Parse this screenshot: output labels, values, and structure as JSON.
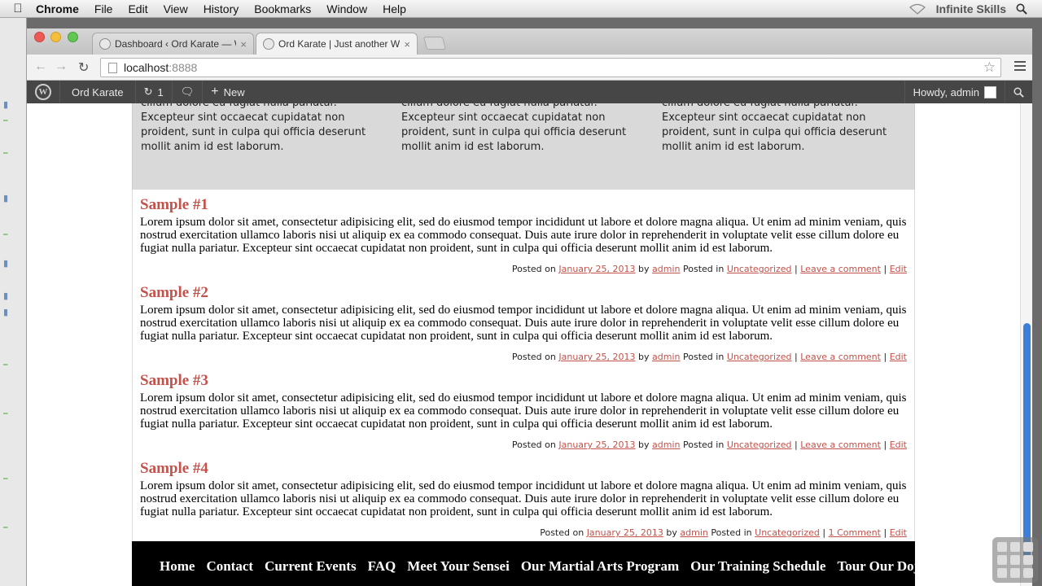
{
  "mac_menu": {
    "app": "Chrome",
    "items": [
      "File",
      "Edit",
      "View",
      "History",
      "Bookmarks",
      "Window",
      "Help"
    ],
    "brand": "Infinite Skills"
  },
  "browser": {
    "tabs": [
      {
        "title": "Dashboard ‹ Ord Karate — W",
        "close": "×"
      },
      {
        "title": "Ord Karate | Just another W",
        "close": "×"
      }
    ],
    "url_host": "localhost",
    "url_port": ":8888"
  },
  "wp_admin_bar": {
    "site_name": "Ord Karate",
    "updates_count": "1",
    "new_label": "New",
    "greeting": "Howdy, admin"
  },
  "footer_widgets": [
    {
      "text": "cillum dolore eu fugiat nulla pariatur. Excepteur sint occaecat cupidatat non proident, sunt in culpa qui officia deserunt mollit anim id est laborum."
    },
    {
      "text": "cillum dolore eu fugiat nulla pariatur. Excepteur sint occaecat cupidatat non proident, sunt in culpa qui officia deserunt mollit anim id est laborum."
    },
    {
      "text": "cillum dolore eu fugiat nulla pariatur. Excepteur sint occaecat cupidatat non proident, sunt in culpa qui officia deserunt mollit anim id est laborum."
    }
  ],
  "posts": [
    {
      "title": "Sample #1",
      "body": "Lorem ipsum dolor sit amet, consectetur adipisicing elit, sed do eiusmod tempor incididunt ut labore et dolore magna aliqua. Ut enim ad minim veniam, quis nostrud exercitation ullamco laboris nisi ut aliquip ex ea commodo consequat. Duis aute irure dolor in reprehenderit in voluptate velit esse cillum dolore eu fugiat nulla pariatur. Excepteur sint occaecat cupidatat non proident, sunt in culpa qui officia deserunt mollit anim id est laborum.",
      "posted_on": "Posted on",
      "date": "January 25, 2013",
      "by": "by",
      "author": "admin",
      "posted_in": "Posted in",
      "category": "Uncategorized",
      "sep": "|",
      "comment": "Leave a comment",
      "edit": "Edit"
    },
    {
      "title": "Sample #2",
      "body": "Lorem ipsum dolor sit amet, consectetur adipisicing elit, sed do eiusmod tempor incididunt ut labore et dolore magna aliqua. Ut enim ad minim veniam, quis nostrud exercitation ullamco laboris nisi ut aliquip ex ea commodo consequat. Duis aute irure dolor in reprehenderit in voluptate velit esse cillum dolore eu fugiat nulla pariatur. Excepteur sint occaecat cupidatat non proident, sunt in culpa qui officia deserunt mollit anim id est laborum.",
      "posted_on": "Posted on",
      "date": "January 25, 2013",
      "by": "by",
      "author": "admin",
      "posted_in": "Posted in",
      "category": "Uncategorized",
      "sep": "|",
      "comment": "Leave a comment",
      "edit": "Edit"
    },
    {
      "title": "Sample #3",
      "body": "Lorem ipsum dolor sit amet, consectetur adipisicing elit, sed do eiusmod tempor incididunt ut labore et dolore magna aliqua. Ut enim ad minim veniam, quis nostrud exercitation ullamco laboris nisi ut aliquip ex ea commodo consequat. Duis aute irure dolor in reprehenderit in voluptate velit esse cillum dolore eu fugiat nulla pariatur. Excepteur sint occaecat cupidatat non proident, sunt in culpa qui officia deserunt mollit anim id est laborum.",
      "posted_on": "Posted on",
      "date": "January 25, 2013",
      "by": "by",
      "author": "admin",
      "posted_in": "Posted in",
      "category": "Uncategorized",
      "sep": "|",
      "comment": "Leave a comment",
      "edit": "Edit"
    },
    {
      "title": "Sample #4",
      "body": "Lorem ipsum dolor sit amet, consectetur adipisicing elit, sed do eiusmod tempor incididunt ut labore et dolore magna aliqua. Ut enim ad minim veniam, quis nostrud exercitation ullamco laboris nisi ut aliquip ex ea commodo consequat. Duis aute irure dolor in reprehenderit in voluptate velit esse cillum dolore eu fugiat nulla pariatur. Excepteur sint occaecat cupidatat non proident, sunt in culpa qui officia deserunt mollit anim id est laborum.",
      "posted_on": "Posted on",
      "date": "January 25, 2013",
      "by": "by",
      "author": "admin",
      "posted_in": "Posted in",
      "category": "Uncategorized",
      "sep": "|",
      "comment": "1 Comment",
      "edit": "Edit"
    }
  ],
  "main_nav": [
    "Home",
    "Contact",
    "Current Events",
    "FAQ",
    "Meet Your Sensei",
    "Our Martial Arts Program",
    "Our Training Schedule",
    "Tour Our Dojo"
  ],
  "colors": {
    "accent": "#c2524b",
    "admin_bar": "#464646",
    "nav_bg": "#000000",
    "scroll_thumb": "#3d7ed9"
  }
}
